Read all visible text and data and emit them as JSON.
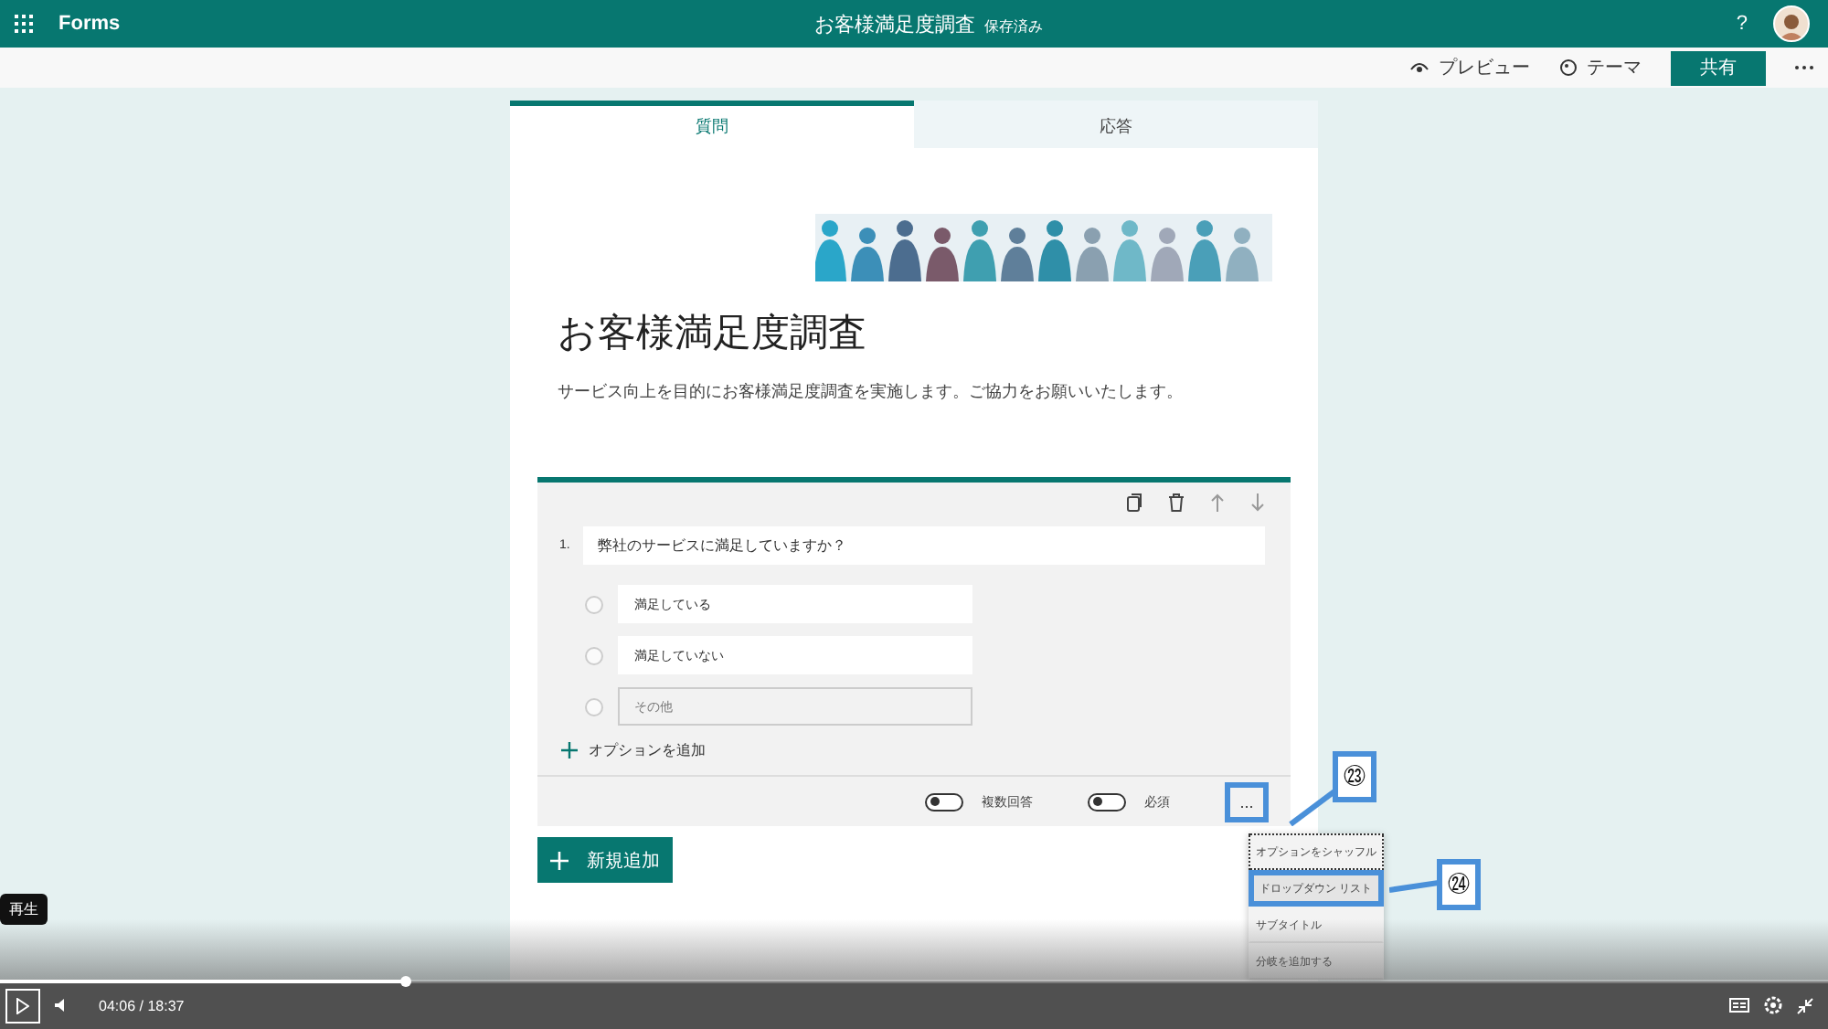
{
  "top_bar": {
    "app_name": "Forms",
    "doc_title": "お客様満足度調査",
    "save_status": "保存済み",
    "help": "?"
  },
  "command_bar": {
    "buttons": [
      {
        "label": "プレビュー",
        "kind": "preview"
      },
      {
        "label": "テーマ",
        "kind": "theme"
      }
    ],
    "share": "共有"
  },
  "tabs": [
    {
      "label": "質問",
      "selected": true
    },
    {
      "label": "応答",
      "selected": false
    }
  ],
  "form": {
    "title": "お客様満足度調査",
    "description": "サービス向上を目的にお客様満足度調査を実施します。ご協力をお願いいたします。"
  },
  "question": {
    "number": "1.",
    "text": "弊社のサービスに満足していますか？",
    "options": [
      {
        "label": "満足している",
        "kind": "option",
        "selected": false
      },
      {
        "label": "満足していない",
        "kind": "option",
        "selected": false
      },
      {
        "label": "その他",
        "kind": "other",
        "selected": false
      }
    ],
    "add_option": "オプションを追加",
    "toggles": [
      {
        "label": "複数回答",
        "on": false
      },
      {
        "label": "必須",
        "on": false
      }
    ],
    "more": "..."
  },
  "add_new": "新規追加",
  "menu": {
    "items": [
      {
        "label": "オプションをシャッフル",
        "focused": true,
        "selected": false
      },
      {
        "label": "ドロップダウン リスト",
        "focused": false,
        "selected": true
      },
      {
        "label": "サブタイトル",
        "focused": false,
        "selected": false
      },
      {
        "label": "分岐を追加する",
        "focused": false,
        "selected": false
      }
    ]
  },
  "callouts": [
    {
      "number": "㉓"
    },
    {
      "number": "㉔"
    }
  ],
  "player": {
    "tooltip": "再生",
    "current_time": "04:06",
    "separator": "/",
    "duration": "18:37",
    "progress": {
      "level": 0.222
    }
  }
}
